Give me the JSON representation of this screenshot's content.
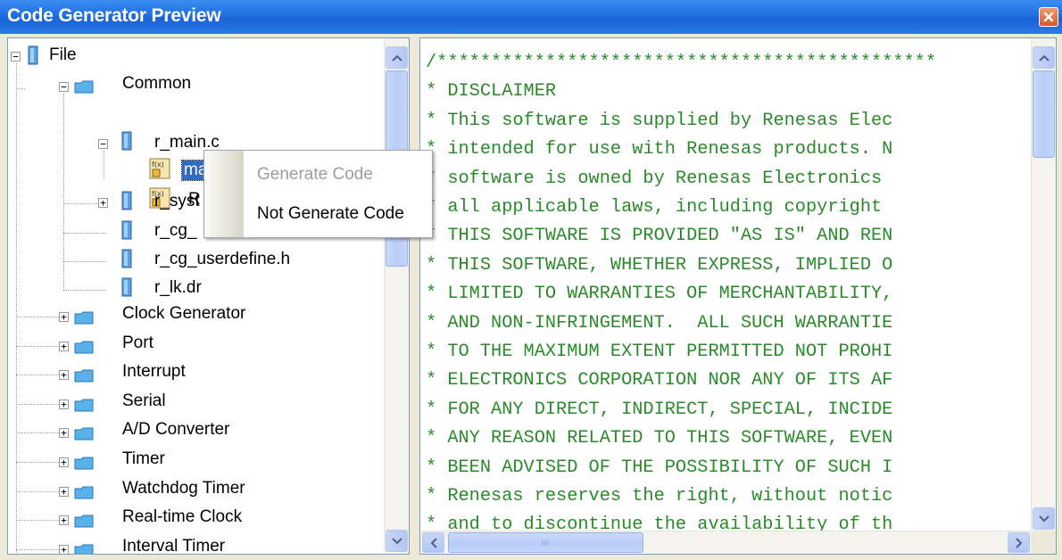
{
  "window": {
    "title": "Code Generator Preview"
  },
  "tree": {
    "items": [
      {
        "label": "File"
      },
      {
        "label": "Common"
      },
      {
        "label": "r_main.c"
      },
      {
        "label": "main"
      },
      {
        "label": "R"
      },
      {
        "label": "r_syst"
      },
      {
        "label": "r_cg_"
      },
      {
        "label": "r_cg_userdefine.h"
      },
      {
        "label": "r_lk.dr"
      },
      {
        "label": "Clock Generator"
      },
      {
        "label": "Port"
      },
      {
        "label": "Interrupt"
      },
      {
        "label": "Serial"
      },
      {
        "label": "A/D Converter"
      },
      {
        "label": "Timer"
      },
      {
        "label": "Watchdog Timer"
      },
      {
        "label": "Real-time Clock"
      },
      {
        "label": "Interval Timer"
      }
    ],
    "expander_plus": "+",
    "expander_minus": "−"
  },
  "context_menu": {
    "items": [
      {
        "label": "Generate Code",
        "enabled": false
      },
      {
        "label": "Not Generate Code",
        "enabled": true
      }
    ]
  },
  "code": {
    "lines": [
      "/**********************************************",
      "* DISCLAIMER",
      "* This software is supplied by Renesas Elec",
      "* intended for use with Renesas products. N",
      "* software is owned by Renesas Electronics",
      "* all applicable laws, including copyright",
      "* THIS SOFTWARE IS PROVIDED \"AS IS\" AND REN",
      "* THIS SOFTWARE, WHETHER EXPRESS, IMPLIED O",
      "* LIMITED TO WARRANTIES OF MERCHANTABILITY,",
      "* AND NON-INFRINGEMENT.  ALL SUCH WARRANTIE",
      "* TO THE MAXIMUM EXTENT PERMITTED NOT PROHI",
      "* ELECTRONICS CORPORATION NOR ANY OF ITS AF",
      "* FOR ANY DIRECT, INDIRECT, SPECIAL, INCIDE",
      "* ANY REASON RELATED TO THIS SOFTWARE, EVEN",
      "* BEEN ADVISED OF THE POSSIBILITY OF SUCH I",
      "* Renesas reserves the right, without notic",
      "* and to discontinue the availability of th"
    ]
  },
  "colors": {
    "code_text": "#2a8a2a",
    "titlebar": "#1f6fe0",
    "selection": "#316ac5"
  },
  "icons": {
    "close": "close-icon",
    "file": "file-icon",
    "folder": "folder-icon",
    "function": "function-icon"
  }
}
